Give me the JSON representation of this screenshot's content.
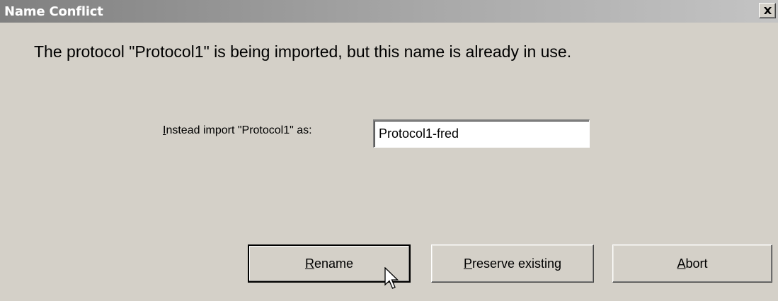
{
  "window": {
    "title": "Name Conflict"
  },
  "message": {
    "text": "The protocol \"Protocol1\" is being imported, but this name is already in use."
  },
  "rename_field": {
    "label_mnemonic": "I",
    "label_rest": "nstead import \"Protocol1\" as:",
    "value": "Protocol1-fred"
  },
  "buttons": {
    "rename": {
      "mnemonic": "R",
      "rest": "ename"
    },
    "preserve": {
      "mnemonic": "P",
      "rest": "reserve existing"
    },
    "abort": {
      "mnemonic": "A",
      "rest": "bort"
    }
  },
  "icons": {
    "close": "close-icon",
    "cursor": "mouse-pointer-icon"
  },
  "colors": {
    "dialog_bg": "#d4d0c8",
    "titlebar_start": "#808080",
    "titlebar_end": "#c4c4c4"
  }
}
